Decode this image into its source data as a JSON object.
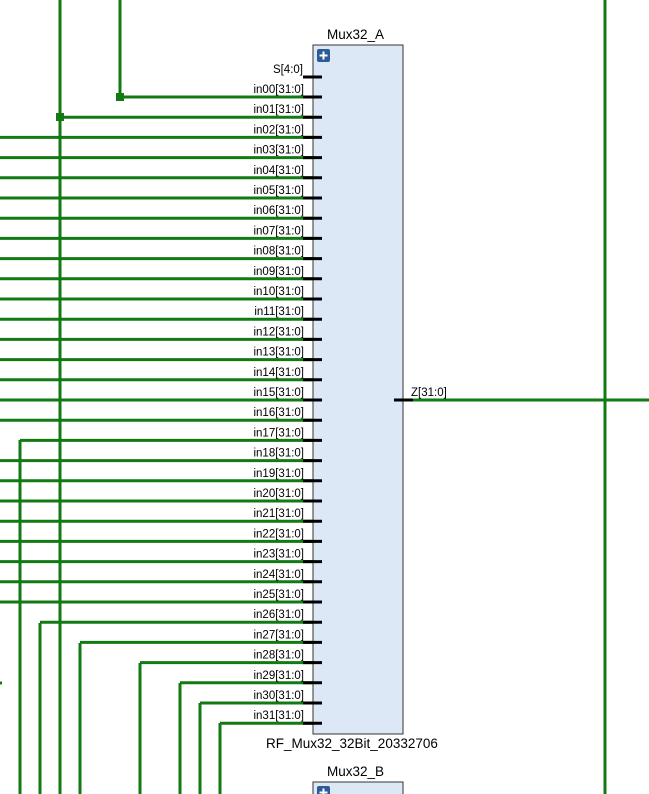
{
  "top_block": {
    "title": "Mux32_A",
    "instance_name": "RF_Mux32_32Bit_20332706",
    "expand_symbol": "+",
    "select_pin": "S[4:0]",
    "input_pins": [
      "in00[31:0]",
      "in01[31:0]",
      "in02[31:0]",
      "in03[31:0]",
      "in04[31:0]",
      "in05[31:0]",
      "in06[31:0]",
      "in07[31:0]",
      "in08[31:0]",
      "in09[31:0]",
      "in10[31:0]",
      "in11[31:0]",
      "in12[31:0]",
      "in13[31:0]",
      "in14[31:0]",
      "in15[31:0]",
      "in16[31:0]",
      "in17[31:0]",
      "in18[31:0]",
      "in19[31:0]",
      "in20[31:0]",
      "in21[31:0]",
      "in22[31:0]",
      "in23[31:0]",
      "in24[31:0]",
      "in25[31:0]",
      "in26[31:0]",
      "in27[31:0]",
      "in28[31:0]",
      "in29[31:0]",
      "in30[31:0]",
      "in31[31:0]"
    ],
    "output_pin": "Z[31:0]"
  },
  "bottom_block": {
    "title": "Mux32_B",
    "expand_symbol": "+"
  },
  "colors": {
    "wire": "#127a12",
    "block_fill": "#dde8f6",
    "block_border": "#333333",
    "pin_tick": "#000000",
    "expand_button": "#2e5a98"
  }
}
